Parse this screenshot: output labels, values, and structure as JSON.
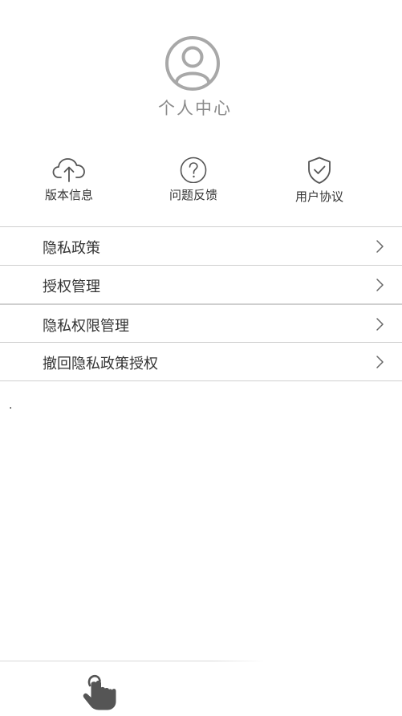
{
  "header": {
    "title": "个人中心",
    "avatar_icon": "user-circle-icon"
  },
  "quick_actions": [
    {
      "label": "版本信息",
      "icon": "cloud-upload-icon"
    },
    {
      "label": "问题反馈",
      "icon": "question-circle-icon"
    },
    {
      "label": "用户协议",
      "icon": "shield-check-icon"
    }
  ],
  "menu": [
    {
      "label": "隐私政策",
      "icon": "chevron-right-icon"
    },
    {
      "label": "授权管理",
      "icon": "chevron-right-icon"
    },
    {
      "label": "隐私权限管理",
      "icon": "chevron-right-icon"
    },
    {
      "label": "撤回隐私政策授权",
      "icon": "chevron-right-icon"
    }
  ],
  "misc": {
    "dot_text": "."
  },
  "bottom": {
    "icon": "tap-hand-icon"
  },
  "colors": {
    "icon_gray": "#555555",
    "avatar_gray": "#a8a8a8",
    "title_gray": "#8a8a8a",
    "divider": "#cfcfcf",
    "text": "#333333"
  }
}
